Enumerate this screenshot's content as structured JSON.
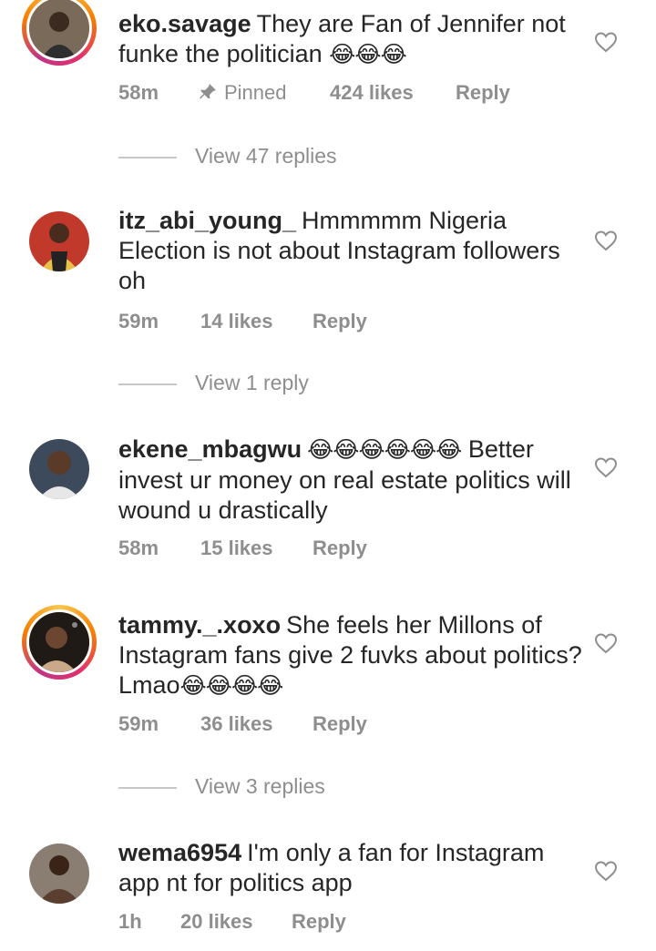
{
  "comments": [
    {
      "username": "eko.savage",
      "text": "They are Fan of Jennifer not funke the politician",
      "emoji": "😂😂😂",
      "time": "58m",
      "pinned_label": "Pinned",
      "likes": "424 likes",
      "reply": "Reply",
      "view_replies": "View 47 replies"
    },
    {
      "username": "itz_abi_young_",
      "text": "Hmmmmm Nigeria Election is not about Instagram followers oh",
      "time": "59m",
      "likes": "14 likes",
      "reply": "Reply",
      "view_replies": "View 1 reply"
    },
    {
      "username": "ekene_mbagwu",
      "emoji": "😂😂😂😂😂😂",
      "text": "Better invest ur money on real estate politics will wound u drastically",
      "time": "58m",
      "likes": "15 likes",
      "reply": "Reply"
    },
    {
      "username": "tammy._.xoxo",
      "text": "She feels her Millons of Instagram fans give 2 fuvks about politics? Lmao",
      "emoji": "😂😂😂😂",
      "time": "59m",
      "likes": "36 likes",
      "reply": "Reply",
      "view_replies": "View 3 replies"
    },
    {
      "username": "wema6954",
      "text": "I'm only a fan for Instagram app nt for politics app",
      "time": "1h",
      "likes": "20 likes",
      "reply": "Reply"
    }
  ]
}
